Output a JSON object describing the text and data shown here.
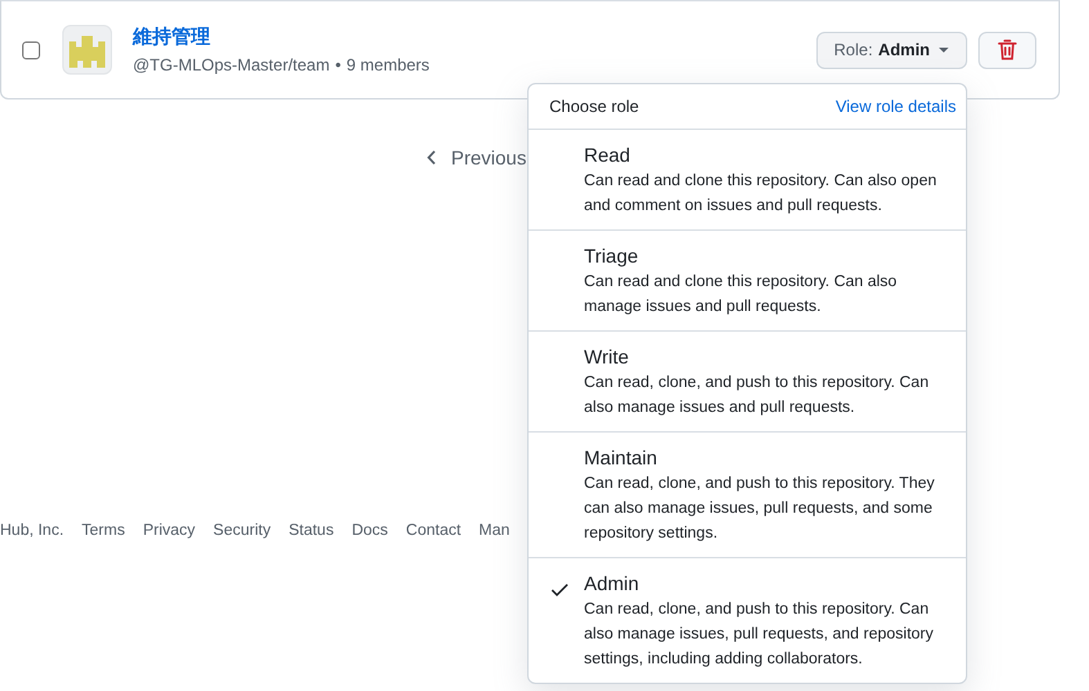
{
  "team": {
    "checked": false,
    "name": "維持管理",
    "handle": "@TG-MLOps-Master/team",
    "separator": "•",
    "members": "9 members",
    "role_label": "Role:",
    "role_value": "Admin"
  },
  "pagination": {
    "previous": "Previous"
  },
  "footer": {
    "links": [
      "Hub, Inc.",
      "Terms",
      "Privacy",
      "Security",
      "Status",
      "Docs",
      "Contact",
      "Man"
    ]
  },
  "role_menu": {
    "title": "Choose role",
    "details_link": "View role details",
    "roles": [
      {
        "name": "Read",
        "description": "Can read and clone this repository. Can also open and comment on issues and pull requests.",
        "selected": false
      },
      {
        "name": "Triage",
        "description": "Can read and clone this repository. Can also manage issues and pull requests.",
        "selected": false
      },
      {
        "name": "Write",
        "description": "Can read, clone, and push to this repository. Can also manage issues and pull requests.",
        "selected": false
      },
      {
        "name": "Maintain",
        "description": "Can read, clone, and push to this repository. They can also manage issues, pull requests, and some repository settings.",
        "selected": false
      },
      {
        "name": "Admin",
        "description": "Can read, clone, and push to this repository. Can also manage issues, pull requests, and repository settings, including adding collaborators.",
        "selected": true
      }
    ]
  }
}
